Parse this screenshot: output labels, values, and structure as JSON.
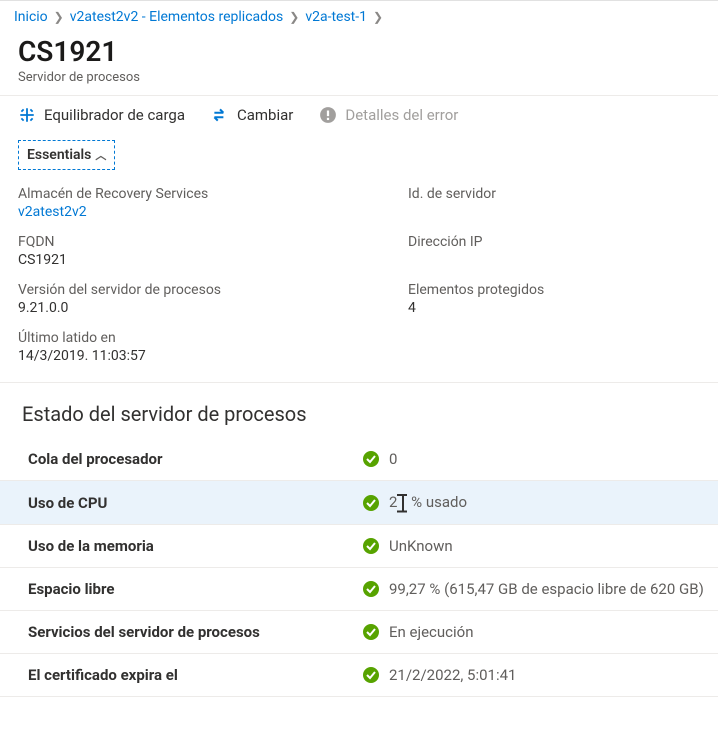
{
  "breadcrumb": {
    "items": [
      {
        "label": "Inicio"
      },
      {
        "label": "v2atest2v2 - Elementos replicados"
      },
      {
        "label": "v2a-test-1"
      }
    ]
  },
  "header": {
    "title": "CS1921",
    "subtitle": "Servidor de procesos"
  },
  "toolbar": {
    "load_balancer": "Equilibrador de carga",
    "switch": "Cambiar",
    "error_details": "Detalles del error"
  },
  "essentials": {
    "toggle_label": "Essentials",
    "recovery_vault": {
      "label": "Almacén de Recovery Services",
      "value": "v2atest2v2"
    },
    "server_id": {
      "label": "Id. de servidor",
      "value": ""
    },
    "fqdn": {
      "label": "FQDN",
      "value": "CS1921"
    },
    "ip": {
      "label": "Dirección IP",
      "value": ""
    },
    "ps_version": {
      "label": "Versión del servidor de procesos",
      "value": "9.21.0.0"
    },
    "protected_items": {
      "label": "Elementos protegidos",
      "value": "4"
    },
    "last_heartbeat": {
      "label": "Último latido en",
      "value": "14/3/2019. 11:03:57"
    }
  },
  "status": {
    "heading": "Estado del servidor de procesos",
    "rows": [
      {
        "label": "Cola del procesador",
        "value": "0"
      },
      {
        "label": "Uso de CPU",
        "value_prefix": "2",
        "value_suffix": " % usado",
        "highlight": true,
        "caret": true
      },
      {
        "label": "Uso de la memoria",
        "value": "UnKnown"
      },
      {
        "label": "Espacio libre",
        "value": "99,27 % (615,47 GB de espacio libre de 620 GB)"
      },
      {
        "label": "Servicios del servidor de procesos",
        "value": "En ejecución"
      },
      {
        "label": "El certificado expira el",
        "value": "21/2/2022, 5:01:41"
      }
    ]
  }
}
